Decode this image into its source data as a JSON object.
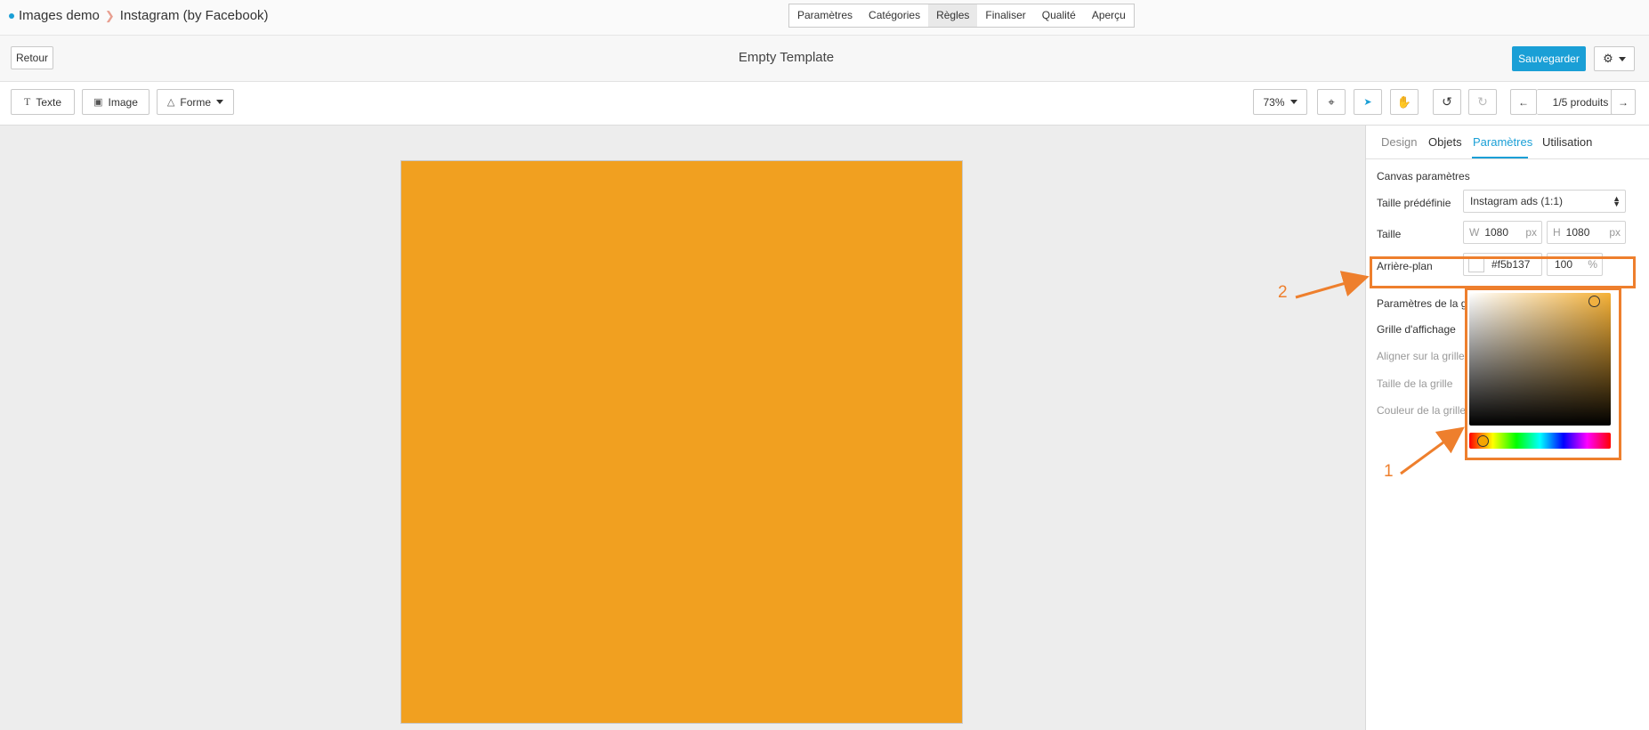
{
  "breadcrumb": {
    "root": "Images demo",
    "current": "Instagram (by Facebook)"
  },
  "steps": [
    "Paramètres",
    "Catégories",
    "Règles",
    "Finaliser",
    "Qualité",
    "Aperçu"
  ],
  "header": {
    "back_label": "Retour",
    "title": "Empty Template",
    "save_label": "Sauvegarder"
  },
  "toolbar": {
    "text_label": "Texte",
    "image_label": "Image",
    "shape_label": "Forme",
    "zoom": "73%",
    "pager": "1/5 produits"
  },
  "canvas": {
    "background": "#f1a020"
  },
  "panel": {
    "tabs": [
      "Design",
      "Objets",
      "Paramètres",
      "Utilisation"
    ],
    "active_tab": "Paramètres",
    "canvas_section_title": "Canvas paramètres",
    "preset_label": "Taille prédéfinie",
    "preset_value": "Instagram ads (1:1)",
    "size_label": "Taille",
    "width_prefix": "W",
    "width_value": "1080",
    "height_prefix": "H",
    "height_value": "1080",
    "unit": "px",
    "background_label": "Arrière-plan",
    "background_hex": "#f5b137",
    "opacity_value": "100",
    "opacity_unit": "%",
    "grid_section_title": "Paramètres de la g",
    "grid_display_label": "Grille d'affichage",
    "snap_label": "Aligner sur la grille",
    "grid_size_label": "Taille de la grille",
    "grid_color_label": "Couleur de la grille"
  },
  "annotations": {
    "first": "1",
    "second": "2",
    "color": "#ee7f2d"
  }
}
